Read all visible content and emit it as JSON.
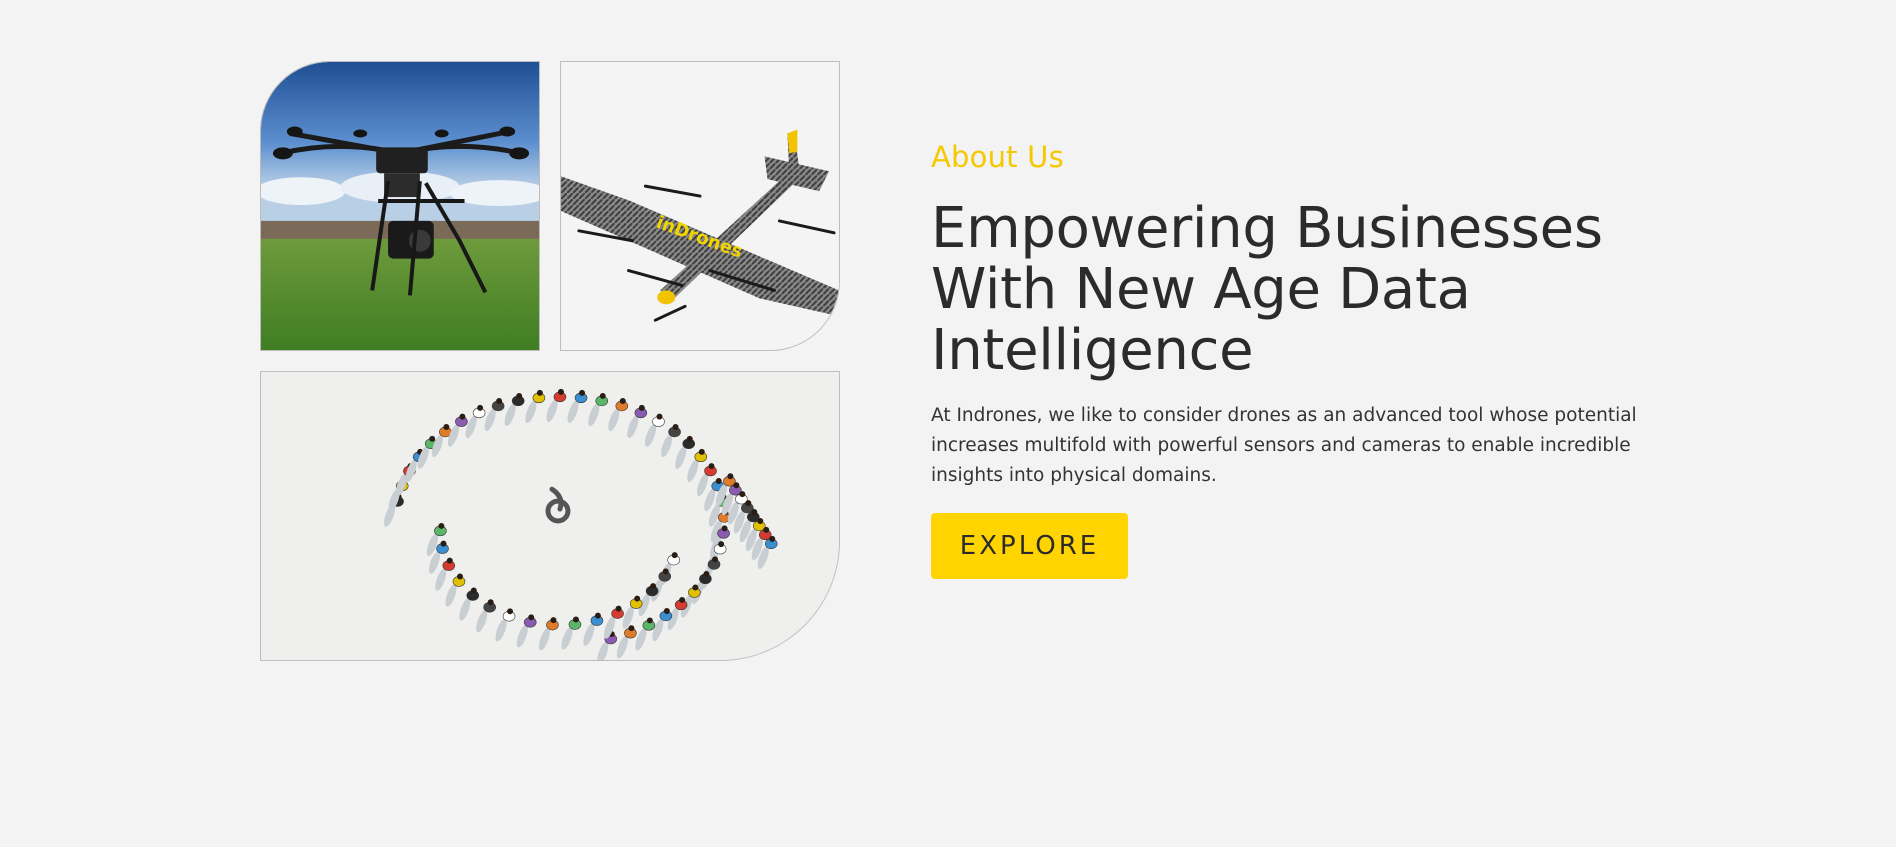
{
  "about": {
    "eyebrow": "About Us",
    "heading": "Empowering Businesses With New Age Data Intelligence",
    "description": "At Indrones, we like to consider drones as an advanced tool whose potential increases multifold with powerful sensors and cameras to enable incredible insights into physical domains.",
    "cta_label": "EXPLORE"
  },
  "images": {
    "plane_brand_text": "inDrones"
  },
  "colors": {
    "accent": "#ffd400",
    "eyebrow": "#f5c800",
    "background": "#f3f3f3",
    "text": "#2b2b2b"
  }
}
